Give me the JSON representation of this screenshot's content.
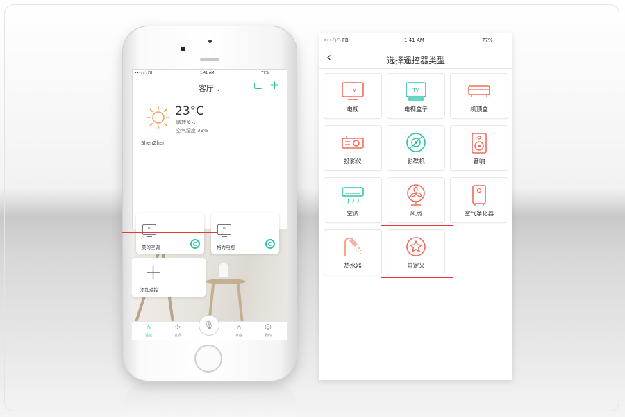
{
  "phone": {
    "status": {
      "carrier": "•••○○ FB",
      "time": "1:41 AM",
      "battery": "77%"
    },
    "room_title": "客厅",
    "weather": {
      "temp": "23°C",
      "desc": "晴转多云",
      "air": "空气湿度 39%",
      "city": "ShenZhen"
    },
    "devices": [
      {
        "label": "美的空调",
        "icon": "tv-icon",
        "badge": "TV"
      },
      {
        "label": "格力电视",
        "icon": "tv-icon",
        "badge": "TV"
      }
    ],
    "add_label": "添加遥控",
    "tabs": [
      {
        "label": "遥控",
        "icon": "home-icon"
      },
      {
        "label": "发现",
        "icon": "discover-icon"
      },
      {
        "label": "",
        "icon": "mic-icon"
      },
      {
        "label": "家庭",
        "icon": "house-icon"
      },
      {
        "label": "我的",
        "icon": "user-icon"
      }
    ]
  },
  "selector": {
    "status": {
      "carrier": "•••○○ FB",
      "time": "1:41 AM",
      "battery": "77%"
    },
    "title": "选择遥控器类型",
    "items": [
      {
        "label": "电视",
        "icon": "tv-icon",
        "color": "#f26b5b"
      },
      {
        "label": "电视盒子",
        "icon": "tv-box-icon",
        "color": "#2fc4a6"
      },
      {
        "label": "机顶盒",
        "icon": "set-top-box-icon",
        "color": "#f26b5b"
      },
      {
        "label": "投影仪",
        "icon": "projector-icon",
        "color": "#f26b5b"
      },
      {
        "label": "影碟机",
        "icon": "disc-player-icon",
        "color": "#2fc4a6"
      },
      {
        "label": "音响",
        "icon": "speaker-icon",
        "color": "#f26b5b"
      },
      {
        "label": "空调",
        "icon": "air-conditioner-icon",
        "color": "#2fc4a6"
      },
      {
        "label": "风扇",
        "icon": "fan-icon",
        "color": "#f26b5b"
      },
      {
        "label": "空气净化器",
        "icon": "air-purifier-icon",
        "color": "#f26b5b"
      },
      {
        "label": "热水器",
        "icon": "water-heater-icon",
        "color": "#f5a48f"
      },
      {
        "label": "自定义",
        "icon": "custom-star-icon",
        "color": "#f26b5b"
      }
    ]
  },
  "colors": {
    "accent": "#2fc4a6",
    "coral": "#f26b5b",
    "highlight": "#e53935"
  }
}
